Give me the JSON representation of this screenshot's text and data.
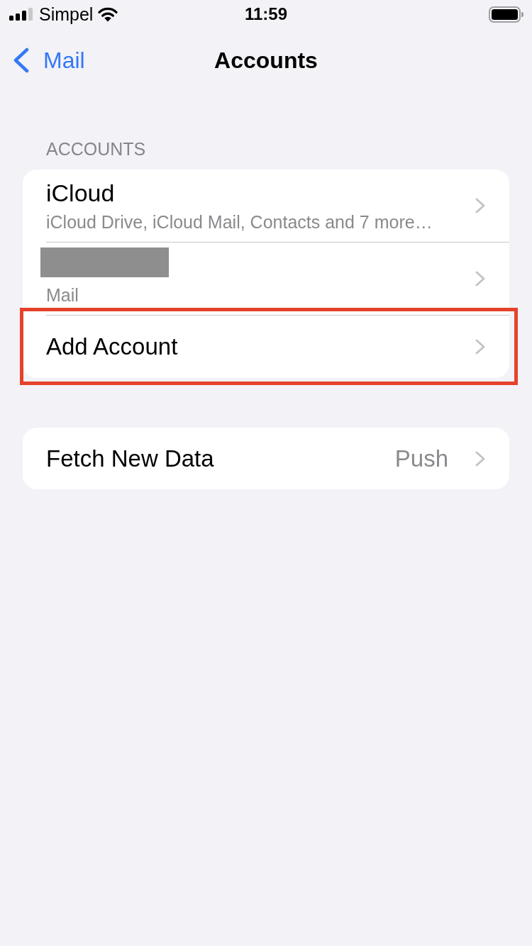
{
  "status_bar": {
    "carrier": "Simpel",
    "time": "11:59"
  },
  "nav_bar": {
    "back_label": "Mail",
    "title": "Accounts"
  },
  "sections": [
    {
      "header": "ACCOUNTS",
      "rows": [
        {
          "kind": "account",
          "title": "iCloud",
          "subtitle": "iCloud Drive, iCloud Mail, Contacts and 7 more…",
          "highlighted": false
        },
        {
          "kind": "redacted_account",
          "subtitle": "Mail",
          "highlighted": false
        },
        {
          "kind": "action",
          "title": "Add Account",
          "highlighted": true
        }
      ]
    },
    {
      "rows": [
        {
          "kind": "setting",
          "title": "Fetch New Data",
          "value": "Push",
          "highlighted": false
        }
      ]
    }
  ]
}
